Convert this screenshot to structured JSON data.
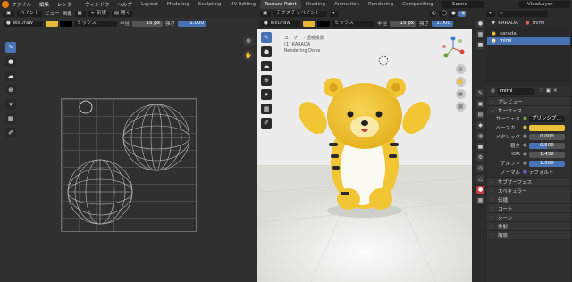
{
  "menu": {
    "items": [
      "ファイル",
      "編集",
      "レンダー",
      "ウィンドウ",
      "ヘルプ"
    ],
    "workspaces": [
      "Layout",
      "Modeling",
      "Sculpting",
      "UV Editing",
      "Texture Paint",
      "Shading",
      "Animation",
      "Rendering",
      "Compositing",
      "Geo"
    ],
    "active_workspace": "Texture Paint",
    "scene": "Scene",
    "view_layer": "ViewLayer"
  },
  "image_editor": {
    "mode": "ペイント",
    "view_menu": "ビュー",
    "image_menu": "画像",
    "new_label": "新規",
    "open_label": "開く",
    "brush": "TexDraw",
    "blend": "ミックス",
    "radius_label": "半径",
    "radius_value": "15 px",
    "strength_label": "強さ",
    "strength_value": "1.000"
  },
  "viewport": {
    "mode": "テクスチャペイント",
    "brush": "TexDraw",
    "blend": "ミックス",
    "radius_label": "半径",
    "radius_value": "15 px",
    "strength_label": "強さ",
    "strength_value": "1.000",
    "info_line1": "ユーザー・透視投影",
    "info_line2": "(1) KARADA",
    "info_line3": "Rendering Done"
  },
  "outliner": {
    "items": [
      {
        "label": "karada",
        "selected": false
      },
      {
        "label": "mimi",
        "selected": true
      }
    ],
    "header_obj": "KARADA",
    "header_mat": "mimi"
  },
  "properties": {
    "material_slot": "mimi",
    "preview_label": "プレビュー",
    "surface_label": "サーフェス",
    "surface_row_label": "サーフェス",
    "surface_shader": "プリンシプ…",
    "base_color_label": "ベースカ…",
    "metallic_label": "メタリック",
    "metallic_value": "0.000",
    "roughness_label": "粗さ",
    "roughness_value": "0.500",
    "ior_label": "IOR",
    "ior_value": "1.450",
    "alpha_label": "アルファ",
    "alpha_value": "1.000",
    "normal_label": "ノーマル",
    "normal_value": "デフォルト",
    "sections": [
      "サブサーフェス",
      "スペキュラー",
      "伝播",
      "コート",
      "シーン",
      "放射",
      "薄膜"
    ]
  },
  "colors": {
    "accent": "#4772b3",
    "base_color": "#ebc13a",
    "bear_yellow": "#f1c533",
    "paint_color": "#e8b73a"
  }
}
